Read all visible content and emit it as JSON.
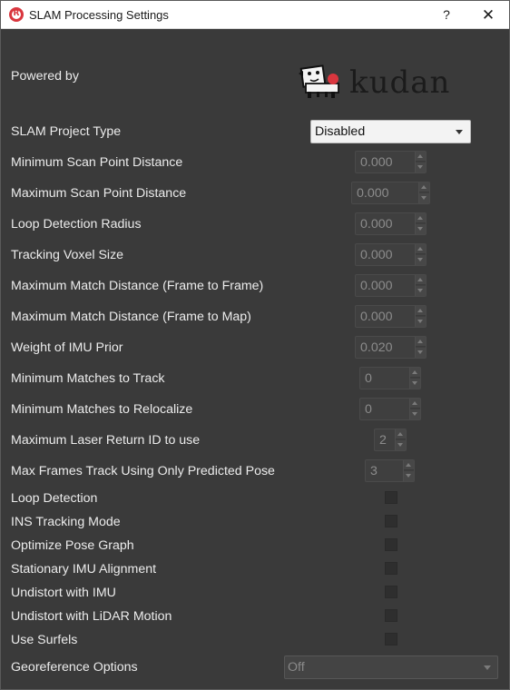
{
  "window": {
    "title": "SLAM Processing Settings",
    "help_label": "?",
    "close_label": "✕",
    "app_icon": "R"
  },
  "header": {
    "powered_by": "Powered by",
    "logo": {
      "name": "kudan-logo",
      "text": "kudan"
    }
  },
  "fields": {
    "slam_project_type": {
      "label": "SLAM Project Type",
      "value": "Disabled"
    },
    "min_scan_point_distance": {
      "label": "Minimum Scan Point Distance",
      "value": "0.000"
    },
    "max_scan_point_distance": {
      "label": "Maximum Scan Point Distance",
      "value": "0.000"
    },
    "loop_detection_radius": {
      "label": "Loop Detection Radius",
      "value": "0.000"
    },
    "tracking_voxel_size": {
      "label": "Tracking Voxel Size",
      "value": "0.000"
    },
    "max_match_dist_f2f": {
      "label": "Maximum Match Distance (Frame to Frame)",
      "value": "0.000"
    },
    "max_match_dist_f2m": {
      "label": "Maximum Match Distance (Frame to Map)",
      "value": "0.000"
    },
    "weight_imu_prior": {
      "label": "Weight of IMU Prior",
      "value": "0.020"
    },
    "min_matches_track": {
      "label": "Minimum Matches to Track",
      "value": "0"
    },
    "min_matches_relocalize": {
      "label": "Minimum Matches to Relocalize",
      "value": "0"
    },
    "max_laser_return_id": {
      "label": "Maximum Laser Return ID to use",
      "value": "2"
    },
    "max_frames_predicted_pose": {
      "label": "Max Frames Track Using Only Predicted Pose",
      "value": "3"
    }
  },
  "checkboxes": {
    "loop_detection": {
      "label": "Loop Detection",
      "checked": false
    },
    "ins_tracking_mode": {
      "label": "INS Tracking Mode",
      "checked": false
    },
    "optimize_pose_graph": {
      "label": "Optimize Pose Graph",
      "checked": false
    },
    "stationary_imu_alignment": {
      "label": "Stationary IMU Alignment",
      "checked": false
    },
    "undistort_imu": {
      "label": "Undistort with IMU",
      "checked": false
    },
    "undistort_lidar_motion": {
      "label": "Undistort with LiDAR Motion",
      "checked": false
    },
    "use_surfels": {
      "label": "Use Surfels",
      "checked": false
    }
  },
  "georeference": {
    "label": "Georeference Options",
    "value": "Off"
  },
  "colors": {
    "background": "#3a3a3a",
    "text": "#ececec",
    "disabled_text": "#8c8c8c",
    "app_icon_red": "#d9363e"
  }
}
